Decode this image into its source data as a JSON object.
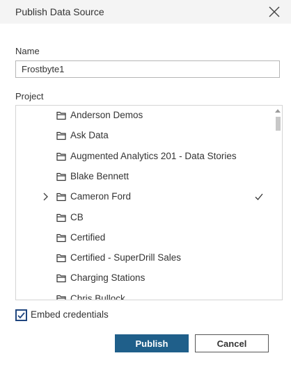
{
  "dialog": {
    "title": "Publish Data Source",
    "close_icon": "close-icon"
  },
  "name_field": {
    "label": "Name",
    "value": "Frostbyte1"
  },
  "project": {
    "label": "Project",
    "selected": "Cameron Ford",
    "items": [
      {
        "label": "Anderson Demos",
        "icon": "folder-icon"
      },
      {
        "label": "Ask Data",
        "icon": "folder-icon"
      },
      {
        "label": "Augmented Analytics 201 - Data Stories",
        "icon": "folder-icon"
      },
      {
        "label": "Blake Bennett",
        "icon": "folder-icon"
      },
      {
        "label": "Cameron Ford",
        "icon": "folder-icon",
        "expander": "chevron-right-icon",
        "check": "checkmark-icon"
      },
      {
        "label": "CB",
        "icon": "folder-icon"
      },
      {
        "label": "Certified",
        "icon": "folder-icon"
      },
      {
        "label": "Certified - SuperDrill Sales",
        "icon": "folder-icon"
      },
      {
        "label": "Charging Stations",
        "icon": "folder-icon"
      },
      {
        "label": "Chris Bullock",
        "icon": "folder-icon"
      }
    ]
  },
  "embed": {
    "label": "Embed credentials",
    "checked": true,
    "accent": "#1f457e"
  },
  "buttons": {
    "publish": "Publish",
    "cancel": "Cancel",
    "publish_color": "#1f5f8a"
  }
}
